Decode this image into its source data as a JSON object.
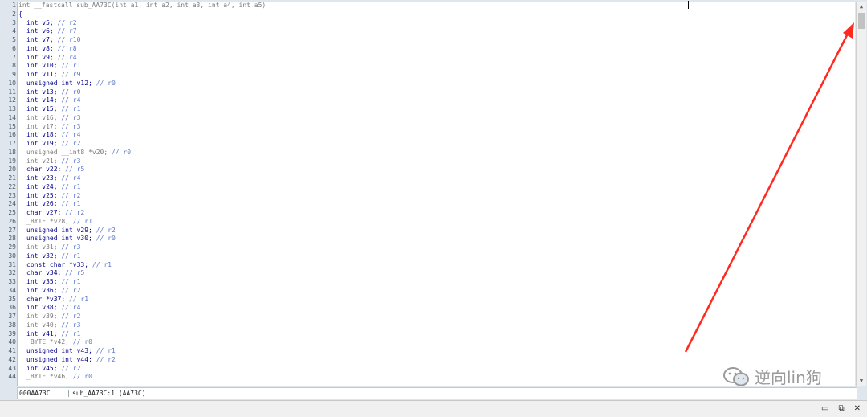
{
  "gutter": [
    "1",
    "2",
    "3",
    "4",
    "5",
    "6",
    "7",
    "8",
    "9",
    "10",
    "11",
    "12",
    "13",
    "14",
    "15",
    "16",
    "17",
    "18",
    "19",
    "20",
    "21",
    "22",
    "23",
    "24",
    "25",
    "26",
    "27",
    "28",
    "29",
    "30",
    "31",
    "32",
    "33",
    "34",
    "35",
    "36",
    "37",
    "38",
    "39",
    "40",
    "41",
    "42",
    "43",
    "44"
  ],
  "code": [
    {
      "g": true,
      "indent": 0,
      "text": "int __fastcall sub_AA73C(int a1, int a2, int a3, int a4, int a5)",
      "comment": ""
    },
    {
      "g": false,
      "indent": 0,
      "text": "{",
      "comment": ""
    },
    {
      "g": false,
      "indent": 1,
      "text": "int v5; ",
      "comment": "// r2"
    },
    {
      "g": false,
      "indent": 1,
      "text": "int v6; ",
      "comment": "// r7"
    },
    {
      "g": false,
      "indent": 1,
      "text": "int v7; ",
      "comment": "// r10"
    },
    {
      "g": false,
      "indent": 1,
      "text": "int v8; ",
      "comment": "// r8"
    },
    {
      "g": false,
      "indent": 1,
      "text": "int v9; ",
      "comment": "// r4"
    },
    {
      "g": false,
      "indent": 1,
      "text": "int v10; ",
      "comment": "// r1"
    },
    {
      "g": false,
      "indent": 1,
      "text": "int v11; ",
      "comment": "// r9"
    },
    {
      "g": false,
      "indent": 1,
      "text": "unsigned int v12; ",
      "comment": "// r0"
    },
    {
      "g": false,
      "indent": 1,
      "text": "int v13; ",
      "comment": "// r0"
    },
    {
      "g": false,
      "indent": 1,
      "text": "int v14; ",
      "comment": "// r4"
    },
    {
      "g": false,
      "indent": 1,
      "text": "int v15; ",
      "comment": "// r1"
    },
    {
      "g": true,
      "indent": 1,
      "text": "int v16; ",
      "comment": "// r3"
    },
    {
      "g": true,
      "indent": 1,
      "text": "int v17; ",
      "comment": "// r3"
    },
    {
      "g": false,
      "indent": 1,
      "text": "int v18; ",
      "comment": "// r4"
    },
    {
      "g": false,
      "indent": 1,
      "text": "int v19; ",
      "comment": "// r2"
    },
    {
      "g": true,
      "indent": 1,
      "text": "unsigned __int8 *v20; ",
      "comment": "// r0"
    },
    {
      "g": true,
      "indent": 1,
      "text": "int v21; ",
      "comment": "// r3"
    },
    {
      "g": false,
      "indent": 1,
      "text": "char v22; ",
      "comment": "// r5"
    },
    {
      "g": false,
      "indent": 1,
      "text": "int v23; ",
      "comment": "// r4"
    },
    {
      "g": false,
      "indent": 1,
      "text": "int v24; ",
      "comment": "// r1"
    },
    {
      "g": false,
      "indent": 1,
      "text": "int v25; ",
      "comment": "// r2"
    },
    {
      "g": false,
      "indent": 1,
      "text": "int v26; ",
      "comment": "// r1"
    },
    {
      "g": false,
      "indent": 1,
      "text": "char v27; ",
      "comment": "// r2"
    },
    {
      "g": true,
      "indent": 1,
      "text": "_BYTE *v28; ",
      "comment": "// r1"
    },
    {
      "g": false,
      "indent": 1,
      "text": "unsigned int v29; ",
      "comment": "// r2"
    },
    {
      "g": false,
      "indent": 1,
      "text": "unsigned int v30; ",
      "comment": "// r0"
    },
    {
      "g": true,
      "indent": 1,
      "text": "int v31; ",
      "comment": "// r3"
    },
    {
      "g": false,
      "indent": 1,
      "text": "int v32; ",
      "comment": "// r1"
    },
    {
      "g": false,
      "indent": 1,
      "text": "const char *v33; ",
      "comment": "// r1"
    },
    {
      "g": false,
      "indent": 1,
      "text": "char v34; ",
      "comment": "// r5"
    },
    {
      "g": false,
      "indent": 1,
      "text": "int v35; ",
      "comment": "// r1"
    },
    {
      "g": false,
      "indent": 1,
      "text": "int v36; ",
      "comment": "// r2"
    },
    {
      "g": false,
      "indent": 1,
      "text": "char *v37; ",
      "comment": "// r1"
    },
    {
      "g": false,
      "indent": 1,
      "text": "int v38; ",
      "comment": "// r4"
    },
    {
      "g": true,
      "indent": 1,
      "text": "int v39; ",
      "comment": "// r2"
    },
    {
      "g": true,
      "indent": 1,
      "text": "int v40; ",
      "comment": "// r3"
    },
    {
      "g": false,
      "indent": 1,
      "text": "int v41; ",
      "comment": "// r1"
    },
    {
      "g": true,
      "indent": 1,
      "text": "_BYTE *v42; ",
      "comment": "// r0"
    },
    {
      "g": false,
      "indent": 1,
      "text": "unsigned int v43; ",
      "comment": "// r1"
    },
    {
      "g": false,
      "indent": 1,
      "text": "unsigned int v44; ",
      "comment": "// r2"
    },
    {
      "g": false,
      "indent": 1,
      "text": "int v45; ",
      "comment": "// r2"
    },
    {
      "g": true,
      "indent": 1,
      "text": "_BYTE *v46; ",
      "comment": "// r0"
    }
  ],
  "status": {
    "address": "000AA73C",
    "location": "sub_AA73C:1 (AA73C)"
  },
  "watermark": {
    "text": "逆向lin狗",
    "icon": "wechat-icon"
  },
  "window_controls": {
    "minimize": "▭",
    "restore": "⧉",
    "close": "✕"
  },
  "scroll_icons": {
    "up": "▲",
    "down": "▼"
  },
  "colors": {
    "keyword": "#00008b",
    "comment": "#5a78c8",
    "inactive": "#7a7a7a",
    "annotation_arrow": "#ff2a1f"
  }
}
